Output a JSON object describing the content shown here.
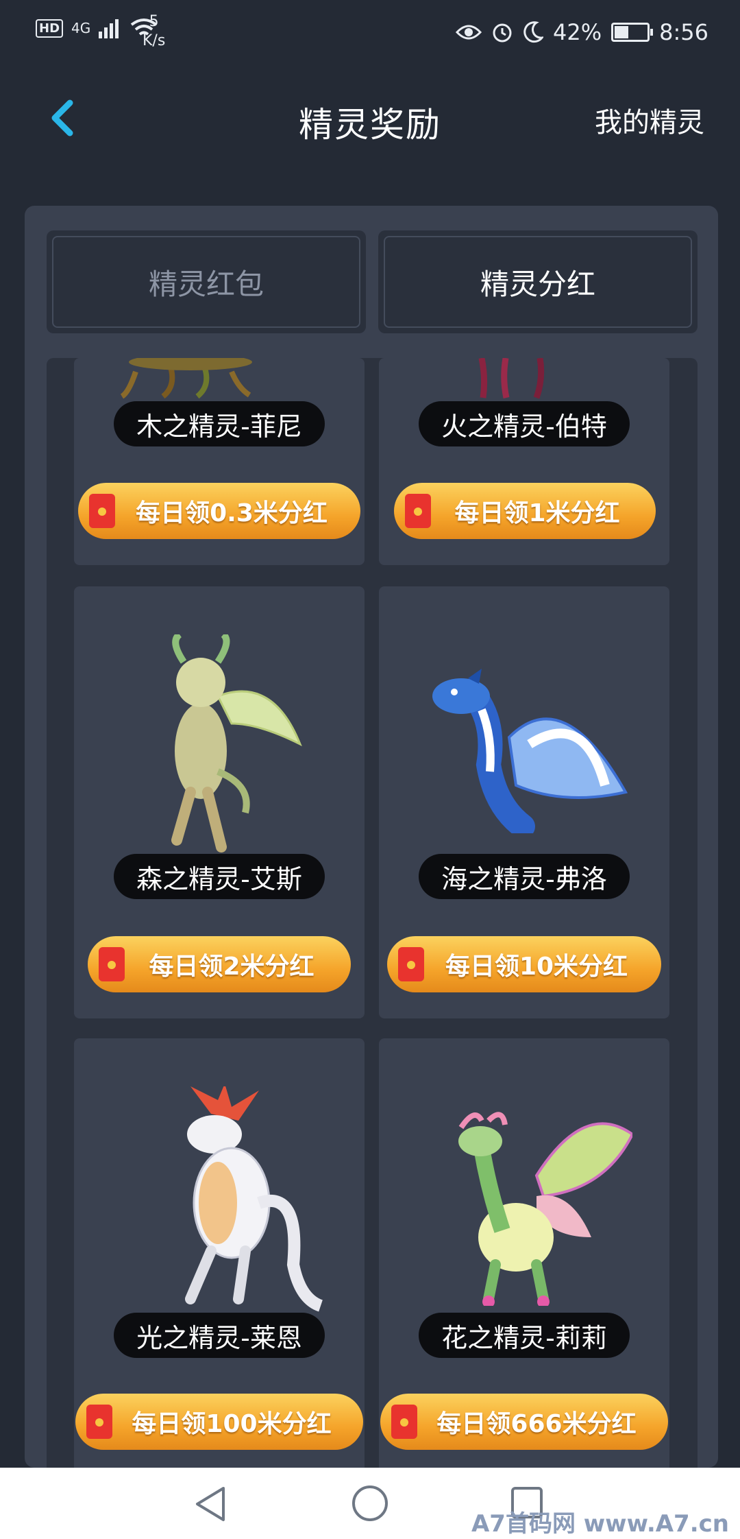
{
  "status_bar": {
    "hd": "HD",
    "network": "4G",
    "speed_value": "5",
    "speed_unit": "K/s",
    "battery": "42%",
    "time": "8:56"
  },
  "header": {
    "title": "精灵奖励",
    "right_link": "我的精灵"
  },
  "tabs": [
    {
      "label": "精灵红包",
      "active": false
    },
    {
      "label": "精灵分红",
      "active": true
    }
  ],
  "sprites": [
    {
      "name": "木之精灵-菲尼",
      "reward": "每日领0.3米分红"
    },
    {
      "name": "火之精灵-伯特",
      "reward": "每日领1米分红"
    },
    {
      "name": "森之精灵-艾斯",
      "reward": "每日领2米分红"
    },
    {
      "name": "海之精灵-弗洛",
      "reward": "每日领10米分红"
    },
    {
      "name": "光之精灵-莱恩",
      "reward": "每日领100米分红"
    },
    {
      "name": "花之精灵-莉莉",
      "reward": "每日领666米分红"
    }
  ],
  "watermark": "A7首码网 www.A7.cn",
  "colors": {
    "background": "#242a35",
    "accent": "#2ab6e8",
    "reward_orange": "#f5a42a"
  }
}
